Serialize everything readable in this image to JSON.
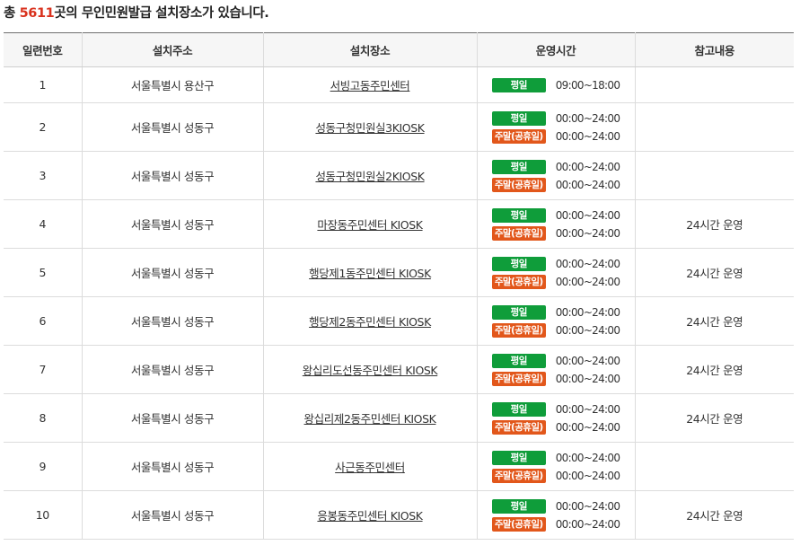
{
  "summary": {
    "prefix": "총 ",
    "count": "5611",
    "suffix": "곳의 무인민원발급 설치장소가 있습니다."
  },
  "colors": {
    "count_accent": "#d9321e",
    "weekday_badge": "#0f9d3a",
    "weekend_badge": "#e2571b"
  },
  "table": {
    "headers": [
      "일련번호",
      "설치주소",
      "설치장소",
      "운영시간",
      "참고내용"
    ],
    "rows": [
      {
        "no": "1",
        "address": "서울특별시 용산구",
        "place": "서빙고동주민센터",
        "hours": [
          {
            "badge": "평일",
            "time": "09:00~18:00"
          }
        ],
        "note": ""
      },
      {
        "no": "2",
        "address": "서울특별시 성동구",
        "place": "성동구청민원실3KIOSK",
        "hours": [
          {
            "badge": "평일",
            "time": "00:00~24:00"
          },
          {
            "badge": "주말(공휴일)",
            "time": "00:00~24:00"
          }
        ],
        "note": ""
      },
      {
        "no": "3",
        "address": "서울특별시 성동구",
        "place": "성동구청민원실2KIOSK",
        "hours": [
          {
            "badge": "평일",
            "time": "00:00~24:00"
          },
          {
            "badge": "주말(공휴일)",
            "time": "00:00~24:00"
          }
        ],
        "note": ""
      },
      {
        "no": "4",
        "address": "서울특별시 성동구",
        "place": "마장동주민센터 KIOSK",
        "hours": [
          {
            "badge": "평일",
            "time": "00:00~24:00"
          },
          {
            "badge": "주말(공휴일)",
            "time": "00:00~24:00"
          }
        ],
        "note": "24시간 운영"
      },
      {
        "no": "5",
        "address": "서울특별시 성동구",
        "place": "행당제1동주민센터 KIOSK",
        "hours": [
          {
            "badge": "평일",
            "time": "00:00~24:00"
          },
          {
            "badge": "주말(공휴일)",
            "time": "00:00~24:00"
          }
        ],
        "note": "24시간 운영"
      },
      {
        "no": "6",
        "address": "서울특별시 성동구",
        "place": "행당제2동주민센터 KIOSK",
        "hours": [
          {
            "badge": "평일",
            "time": "00:00~24:00"
          },
          {
            "badge": "주말(공휴일)",
            "time": "00:00~24:00"
          }
        ],
        "note": "24시간 운영"
      },
      {
        "no": "7",
        "address": "서울특별시 성동구",
        "place": "왕십리도선동주민센터 KIOSK",
        "hours": [
          {
            "badge": "평일",
            "time": "00:00~24:00"
          },
          {
            "badge": "주말(공휴일)",
            "time": "00:00~24:00"
          }
        ],
        "note": "24시간 운영"
      },
      {
        "no": "8",
        "address": "서울특별시 성동구",
        "place": "왕십리제2동주민센터 KIOSK",
        "hours": [
          {
            "badge": "평일",
            "time": "00:00~24:00"
          },
          {
            "badge": "주말(공휴일)",
            "time": "00:00~24:00"
          }
        ],
        "note": "24시간 운영"
      },
      {
        "no": "9",
        "address": "서울특별시 성동구",
        "place": "사근동주민센터",
        "hours": [
          {
            "badge": "평일",
            "time": "00:00~24:00"
          },
          {
            "badge": "주말(공휴일)",
            "time": "00:00~24:00"
          }
        ],
        "note": ""
      },
      {
        "no": "10",
        "address": "서울특별시 성동구",
        "place": "응봉동주민센터 KIOSK",
        "hours": [
          {
            "badge": "평일",
            "time": "00:00~24:00"
          },
          {
            "badge": "주말(공휴일)",
            "time": "00:00~24:00"
          }
        ],
        "note": "24시간 운영"
      }
    ]
  }
}
